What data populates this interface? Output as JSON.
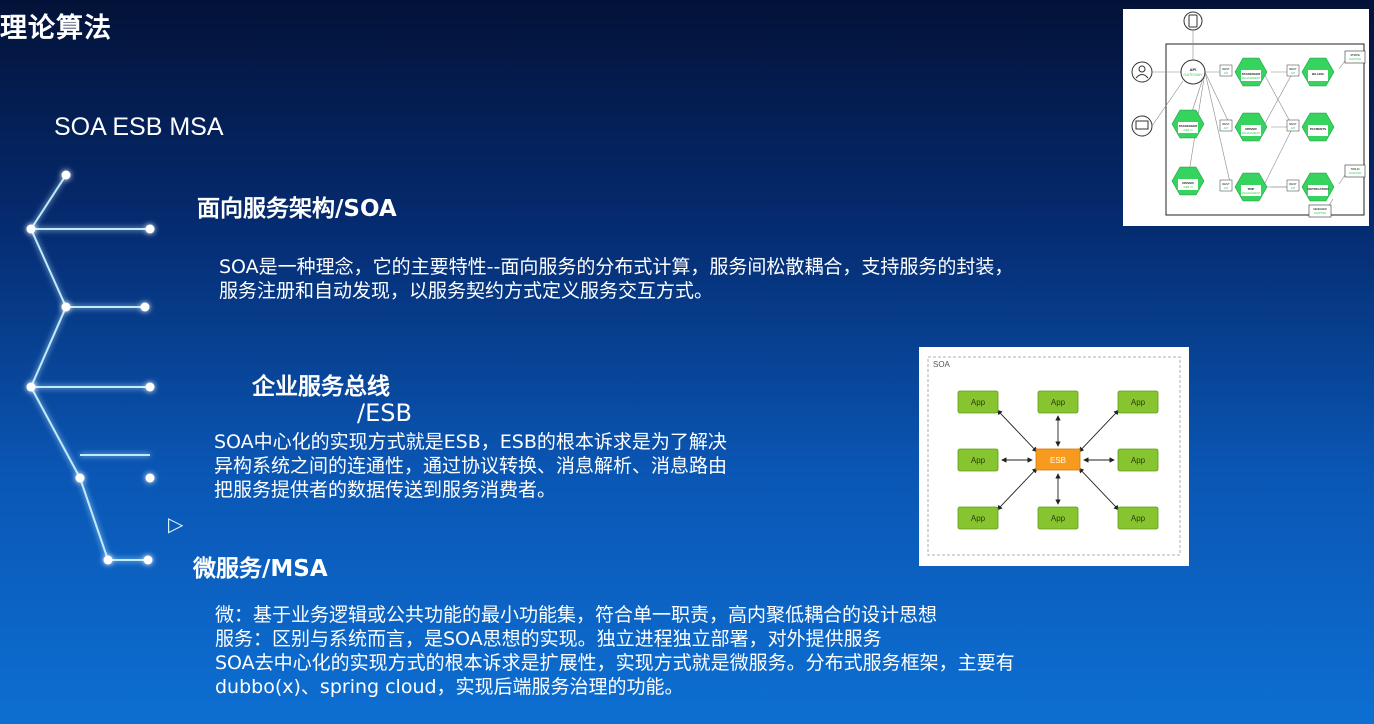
{
  "title": "理论算法",
  "subtitle": "SOA ESB MSA",
  "sections": {
    "soa": {
      "heading": "面向服务架构/SOA",
      "lines": [
        "SOA是一种理念，它的主要特性--面向服务的分布式计算，服务间松散耦合，支持服务的封装，",
        "服务注册和自动发现，以服务契约方式定义服务交互方式。"
      ]
    },
    "esb": {
      "heading_line1": "企业服务总线",
      "heading_line2": "/ESB",
      "lines": [
        "SOA中心化的实现方式就是ESB，ESB的根本诉求是为了解决",
        "异构系统之间的连通性，通过协议转换、消息解析、消息路由",
        "把服务提供者的数据传送到服务消费者。"
      ]
    },
    "msa": {
      "heading": "微服务/MSA",
      "lines": [
        "微：基于业务逻辑或公共功能的最小功能集，符合单一职责，高内聚低耦合的设计思想",
        "服务：区别与系统而言，是SOA思想的实现。独立进程独立部署，对外提供服务",
        "SOA去中心化的实现方式的根本诉求是扩展性，实现方式就是微服务。分布式服务框架，主要有",
        "dubbo(x)、spring cloud，实现后端服务治理的功能。"
      ]
    }
  },
  "play_glyph": "▷",
  "esb_diagram": {
    "frame_label": "SOA",
    "hub_label": "ESB",
    "app_label": "App"
  },
  "ms_diagram": {
    "gateway": [
      "API",
      "GATEWAY"
    ],
    "rest": [
      "REST",
      "API"
    ],
    "nodes": {
      "passenger_mgmt": [
        "PASSENGER",
        "MANAGEMENT"
      ],
      "billing": "BILLING",
      "passenger_web": [
        "PASSENGER",
        "WEB UI"
      ],
      "driver_mgmt": [
        "DRIVER",
        "MANAGEMENT"
      ],
      "payments": "PAYMENTS",
      "driver_web": [
        "DRIVER",
        "WEB UI"
      ],
      "trip_mgmt": [
        "TRIP",
        "MANAGEMENT"
      ],
      "notification": "NOTIFICATION"
    },
    "adapters": {
      "stripe": [
        "STRIPE",
        "ADAPTER"
      ],
      "twilio": [
        "TWILIO",
        "ADAPTER"
      ],
      "sendgrid": [
        "SENDGRID",
        "ADAPTER"
      ]
    }
  },
  "colors": {
    "accent_green": "#36d35f",
    "esb_orange": "#f79a1e",
    "app_green": "#86c52f",
    "tree_line": "#bfeaff"
  }
}
